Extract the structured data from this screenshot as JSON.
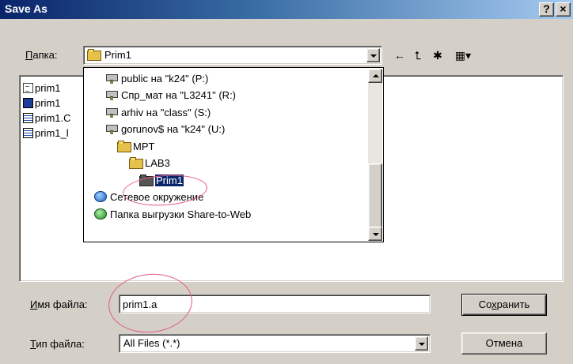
{
  "window": {
    "title": "Save As",
    "help_glyph": "?",
    "close_glyph": "×"
  },
  "folder": {
    "label_prefix": "П",
    "label_rest": "апка:",
    "current_value": "Prim1"
  },
  "toolbar": {
    "back_icon": "←",
    "up_folder_icon": "⮤",
    "new_folder_icon": "✱",
    "view_menu_icon": "▦▾"
  },
  "files": [
    {
      "name": "prim1",
      "icon": "doc-icon"
    },
    {
      "name": "prim1",
      "icon": "mathcad-icon"
    },
    {
      "name": "prim1.C",
      "icon": "grid-icon"
    },
    {
      "name": "prim1_l",
      "icon": "grid-icon"
    }
  ],
  "dropdown_items": [
    {
      "label": "public на \"k24\" (P:)",
      "icon": "network-drive-icon",
      "indent": 0
    },
    {
      "label": "Спр_мат на \"L3241\" (R:)",
      "icon": "network-drive-icon",
      "indent": 0
    },
    {
      "label": "arhiv на \"class\" (S:)",
      "icon": "network-drive-icon",
      "indent": 0
    },
    {
      "label": "gorunov$ на \"k24\" (U:)",
      "icon": "network-drive-icon",
      "indent": 0
    },
    {
      "label": "MPT",
      "icon": "folder-icon",
      "indent": 1
    },
    {
      "label": "LAB3",
      "icon": "folder-icon",
      "indent": 2
    },
    {
      "label": "Prim1",
      "icon": "open-folder-icon",
      "indent": 3,
      "selected": true
    },
    {
      "label": "Сетевое окружение",
      "icon": "network-places-icon",
      "indent": 0
    },
    {
      "label": "Папка выгрузки Share-to-Web",
      "icon": "web-folder-icon",
      "indent": 0
    }
  ],
  "filename": {
    "label_prefix": "И",
    "label_rest": "мя файла:",
    "value": "prim1.a"
  },
  "filetype": {
    "label_prefix": "Т",
    "label_rest": "ип файла:",
    "value": "All Files (*.*)"
  },
  "buttons": {
    "save_prefix": "Со",
    "save_underlined": "х",
    "save_rest": "ранить",
    "cancel": "Отмена"
  },
  "colors": {
    "title_bar": "#0a246a",
    "selection": "#0a246a",
    "annotation": "#e25b82",
    "dialog_face": "#d4d0c8"
  }
}
